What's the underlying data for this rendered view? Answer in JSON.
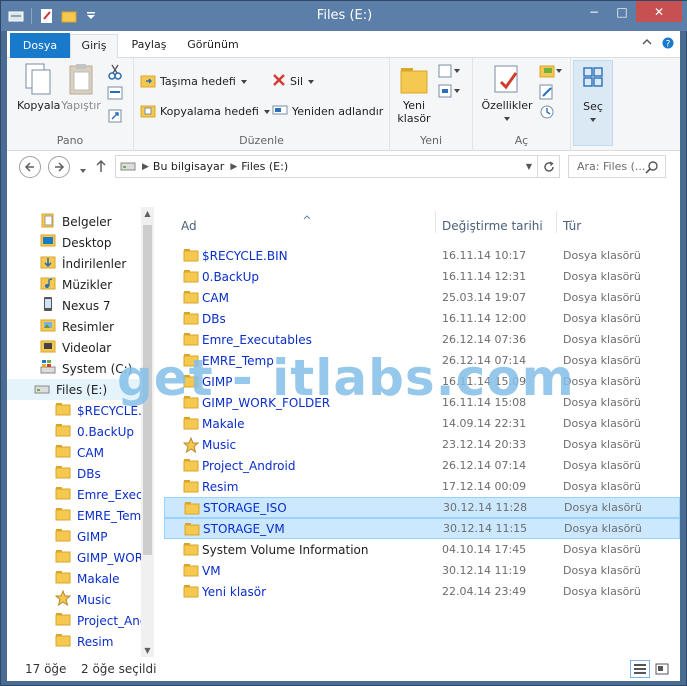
{
  "window": {
    "title": "Files (E:)",
    "min": "−",
    "max": "□",
    "close": "✕"
  },
  "ribbon_tabs": {
    "file": "Dosya",
    "home": "Giriş",
    "share": "Paylaş",
    "view": "Görünüm"
  },
  "ribbon": {
    "copy": "Kopyala",
    "paste": "Yapıştır",
    "clipboard_group": "Pano",
    "move_to": "Taşıma hedefi",
    "copy_to": "Kopyalama hedefi",
    "delete": "Sil",
    "rename": "Yeniden adlandır",
    "organize_group": "Düzenle",
    "new_folder_line1": "Yeni",
    "new_folder_line2": "klasör",
    "new_group": "Yeni",
    "properties": "Özellikler",
    "open_group": "Aç",
    "select": "Seç"
  },
  "address": {
    "crumbs": [
      "Bu bilgisayar",
      "Files (E:)"
    ],
    "search_placeholder": "Ara: Files (..."
  },
  "nav": {
    "items": [
      {
        "label": "Belgeler",
        "icon": "documents-icon"
      },
      {
        "label": "Desktop",
        "icon": "desktop-icon"
      },
      {
        "label": "İndirilenler",
        "icon": "downloads-icon"
      },
      {
        "label": "Müzikler",
        "icon": "music-library-icon"
      },
      {
        "label": "Nexus 7",
        "icon": "phone-icon"
      },
      {
        "label": "Resimler",
        "icon": "pictures-icon"
      },
      {
        "label": "Videolar",
        "icon": "videos-icon"
      },
      {
        "label": "System (C:)",
        "icon": "windows-drive-icon"
      },
      {
        "label": "Files (E:)",
        "icon": "drive-icon"
      }
    ],
    "subitems": [
      "$RECYCLE.BIN",
      "0.BackUp",
      "CAM",
      "DBs",
      "Emre_Executables",
      "EMRE_Temp",
      "GIMP",
      "GIMP_WORK_FOLDER",
      "Makale",
      "Music",
      "Project_Android",
      "Resim"
    ]
  },
  "columns": {
    "name": "Ad",
    "date": "Değiştirme tarihi",
    "type": "Tür"
  },
  "files": [
    {
      "name": "$RECYCLE.BIN",
      "date": "16.11.14 10:17",
      "type": "Dosya klasörü",
      "link": true,
      "selected": false,
      "icon": "folder"
    },
    {
      "name": "0.BackUp",
      "date": "16.11.14 12:31",
      "type": "Dosya klasörü",
      "link": true,
      "selected": false,
      "icon": "folder"
    },
    {
      "name": "CAM",
      "date": "25.03.14 19:07",
      "type": "Dosya klasörü",
      "link": true,
      "selected": false,
      "icon": "folder"
    },
    {
      "name": "DBs",
      "date": "16.11.14 12:00",
      "type": "Dosya klasörü",
      "link": true,
      "selected": false,
      "icon": "folder"
    },
    {
      "name": "Emre_Executables",
      "date": "26.12.14 07:36",
      "type": "Dosya klasörü",
      "link": true,
      "selected": false,
      "icon": "folder"
    },
    {
      "name": "EMRE_Temp",
      "date": "26.12.14 07:14",
      "type": "Dosya klasörü",
      "link": true,
      "selected": false,
      "icon": "folder"
    },
    {
      "name": "GIMP",
      "date": "16.11.14 15:09",
      "type": "Dosya klasörü",
      "link": true,
      "selected": false,
      "icon": "folder"
    },
    {
      "name": "GIMP_WORK_FOLDER",
      "date": "16.11.14 15:08",
      "type": "Dosya klasörü",
      "link": true,
      "selected": false,
      "icon": "folder"
    },
    {
      "name": "Makale",
      "date": "14.09.14 22:31",
      "type": "Dosya klasörü",
      "link": true,
      "selected": false,
      "icon": "folder"
    },
    {
      "name": "Music",
      "date": "23.12.14 20:33",
      "type": "Dosya klasörü",
      "link": true,
      "selected": false,
      "icon": "star"
    },
    {
      "name": "Project_Android",
      "date": "26.12.14 07:14",
      "type": "Dosya klasörü",
      "link": true,
      "selected": false,
      "icon": "folder"
    },
    {
      "name": "Resim",
      "date": "17.12.14 00:09",
      "type": "Dosya klasörü",
      "link": true,
      "selected": false,
      "icon": "folder"
    },
    {
      "name": "STORAGE_ISO",
      "date": "30.12.14 11:28",
      "type": "Dosya klasörü",
      "link": true,
      "selected": true,
      "icon": "folder"
    },
    {
      "name": "STORAGE_VM",
      "date": "30.12.14 11:15",
      "type": "Dosya klasörü",
      "link": true,
      "selected": true,
      "icon": "folder"
    },
    {
      "name": "System Volume Information",
      "date": "04.10.14 17:45",
      "type": "Dosya klasörü",
      "link": false,
      "selected": false,
      "icon": "folder"
    },
    {
      "name": "VM",
      "date": "30.12.14 11:19",
      "type": "Dosya klasörü",
      "link": true,
      "selected": false,
      "icon": "folder"
    },
    {
      "name": "Yeni klasör",
      "date": "22.04.14 23:49",
      "type": "Dosya klasörü",
      "link": true,
      "selected": false,
      "icon": "folder"
    }
  ],
  "status": {
    "count": "17 öğe",
    "selected": "2 öğe seçildi"
  },
  "watermark": "get - itlabs.com"
}
